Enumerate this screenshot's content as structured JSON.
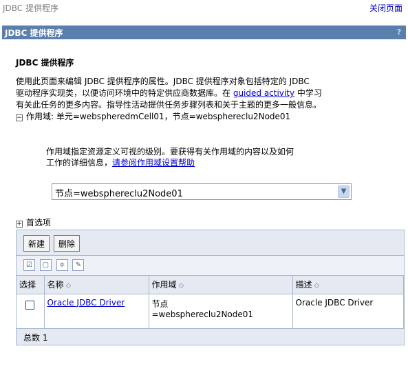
{
  "topbar": {
    "crumb": "JDBC 提供程序",
    "close_label": "关闭页面"
  },
  "title": {
    "label": "JDBC 提供程序",
    "help": "?"
  },
  "heading": "JDBC 提供程序",
  "description": {
    "line1": "使用此页面来编辑 JDBC 提供程序的属性。JDBC 提供程序对象包括特定的 JDBC",
    "line2_pre": "驱动程序实现类，以便访问环境中的特定供应商数据库。在 ",
    "link": "guided activity",
    "line2_post": " 中学习",
    "line3": "有关此任务的更多内容。指导性活动提供任务步骤列表和关于主题的更多一般信息。"
  },
  "scope": {
    "toggle": "日",
    "label": "作用域: 单元=webspheredmCell01，节点=websphereclu2Node01",
    "help_line1": "作用域指定资源定义可视的级别。要获得有关作用域的内容以及如何",
    "help_line2": "工作的详细信息，",
    "help_link": "请参阅作用域设置帮助",
    "select_value": "节点=websphereclu2Node01"
  },
  "preferences": {
    "toggle": "田",
    "label": "首选项"
  },
  "toolbar": {
    "new_label": "新建",
    "delete_label": "删除"
  },
  "icons": [
    "select-all-icon",
    "deselect-all-icon",
    "filter-icon",
    "edit-filter-icon"
  ],
  "table": {
    "headers": {
      "select": "选择",
      "name": "名称",
      "scope": "作用域",
      "desc": "描述"
    },
    "rows": [
      {
        "name": "Oracle JDBC Driver",
        "scope_line1": "节点",
        "scope_line2": "=websphereclu2Node01",
        "desc": "Oracle JDBC Driver"
      }
    ],
    "total": "总数 1"
  }
}
